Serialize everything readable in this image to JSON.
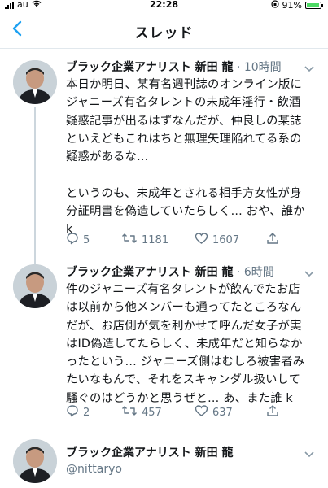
{
  "status_bar": {
    "carrier": "au",
    "time": "22:28",
    "battery_percent": "91%",
    "battery_level": 0.91
  },
  "nav": {
    "title": "スレッド"
  },
  "tweets": [
    {
      "display_name": "ブラック企業アナリスト 新田 龍",
      "time": "10時間",
      "text": "本日か明日、某有名週刊誌のオンライン版に\nジャニーズ有名タレントの未成年淫行・飲酒\n疑惑記事が出るはずなんだが、仲良しの某誌\nといえどもこれはちと無理矢理陥れてる系の\n疑惑があるな…\n\nというのも、未成年とされる相手方女性が身\n分証明書を偽造していたらしく… おや、誰か\nk",
      "replies": "5",
      "retweets": "1181",
      "likes": "1607"
    },
    {
      "display_name": "ブラック企業アナリスト 新田 龍",
      "time": "6時間",
      "text": "件のジャニーズ有名タレントが飲んでたお店\nは以前から他メンバーも通ってたところなん\nだが、お店側が気を利かせて呼んだ女子が実\nはID偽造してたらしく、未成年だと知らなか\nったという… ジャニーズ側はむしろ被害者み\nたいなもんで、それをスキャンダル扱いして\n騒ぐのはどうかと思うぜと… あ、また誰 k",
      "replies": "2",
      "retweets": "457",
      "likes": "637"
    },
    {
      "display_name": "ブラック企業アナリスト 新田 龍",
      "handle": "@nittaryo"
    }
  ],
  "colors": {
    "accent": "#1da1f2",
    "secondary_text": "#657786",
    "divider": "#e1e8ed"
  },
  "icons": [
    "back-chevron-icon",
    "caret-down-icon",
    "reply-icon",
    "retweet-icon",
    "like-icon",
    "share-icon"
  ]
}
